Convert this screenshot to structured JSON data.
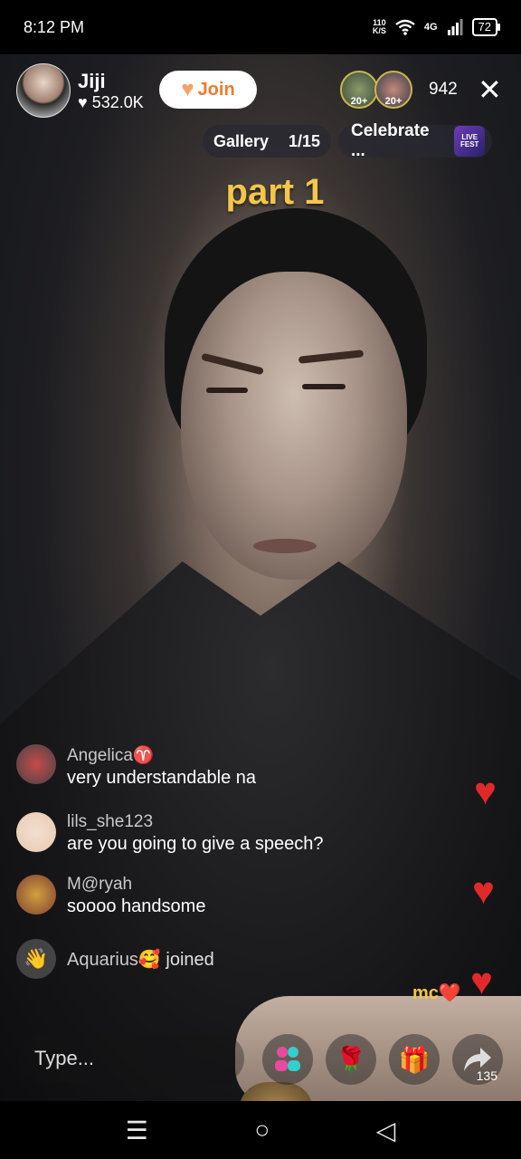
{
  "status_bar": {
    "time": "8:12 PM",
    "net_speed_value": "110",
    "net_speed_unit": "K/S",
    "network": "4G",
    "battery": "72",
    "icons": [
      "wifi-icon",
      "signal-icon",
      "battery-icon"
    ]
  },
  "header": {
    "host_name": "Jiji",
    "host_likes": "532.0K",
    "join_label": "Join",
    "viewer_badges": [
      "20+",
      "20+"
    ],
    "viewer_count": "942",
    "close_icon": "close-icon"
  },
  "sub_bar": {
    "gallery_label": "Gallery",
    "gallery_position": "1/15",
    "celebrate_label": "Celebrate ...",
    "fest_badge": "LIVE FEST"
  },
  "overlay_text": "part 1",
  "chat": [
    {
      "user": "Angelica♈",
      "message": "very understandable na"
    },
    {
      "user": "lils_she123",
      "message": "are you going to give a speech?"
    },
    {
      "user": "M@ryah",
      "message": "soooo handsome"
    }
  ],
  "joined": {
    "user": "Aquarius🥰",
    "text": "joined"
  },
  "mc_tag": "mc❤️",
  "bottom_bar": {
    "input_placeholder": "Type...",
    "share_count": "135",
    "icons": [
      "friends-icon",
      "rose-gift-icon",
      "gift-icon",
      "share-icon"
    ]
  },
  "nav": {
    "icons": [
      "menu-icon",
      "home-icon",
      "back-icon"
    ]
  },
  "colors": {
    "accent_yellow": "#f4c64a",
    "join_orange": "#f07a2a",
    "heart_red": "#e02a2a"
  }
}
